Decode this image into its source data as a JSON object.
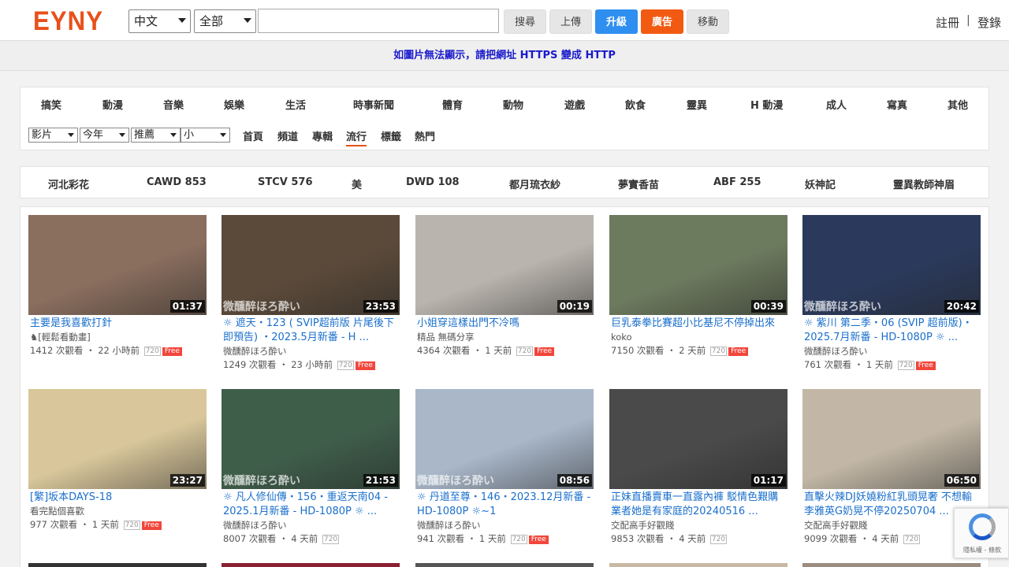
{
  "header": {
    "logo": "EYNY",
    "lang_select": "中文",
    "scope_select": "全部",
    "search_placeholder": "",
    "buttons": {
      "search": "搜尋",
      "upload": "上傳",
      "upgrade": "升級",
      "ads": "廣告",
      "mobile": "移動"
    },
    "register": "註冊",
    "separator": "|",
    "login": "登錄"
  },
  "notice": "如圖片無法顯示，請把網址 HTTPS 變成 HTTP",
  "categories": [
    "搞笑",
    "動漫",
    "音樂",
    "娛樂",
    "生活",
    "時事新聞",
    "體育",
    "動物",
    "遊戲",
    "飲食",
    "靈異",
    "H 動漫",
    "成人",
    "寫真",
    "其他"
  ],
  "filters": {
    "type": "影片",
    "time": "今年",
    "sort": "推薦",
    "size": "小"
  },
  "subnav": [
    "首頁",
    "頻道",
    "專輯",
    "流行",
    "標籤",
    "熱門"
  ],
  "subnav_active": "流行",
  "tags": [
    "河北彩花",
    "CAWD 853",
    "STCV 576",
    "美",
    "DWD 108",
    "都月琉衣紗",
    "夢實香苗",
    "ABF 255",
    "妖神記",
    "靈異教師神眉"
  ],
  "videos": [
    {
      "title": "主要是我喜歡打針",
      "uploader": "♞[輕鬆看動畫]",
      "views": "1412 次觀看",
      "ago": "22 小時前",
      "quality": "720",
      "free": "Free",
      "duration": "01:37",
      "thumb_color": "#8a6e5e"
    },
    {
      "title": "☼ 遮天・123 ( SVIP超前版 片尾後下即預告) ・2023.5月新番 - H ...",
      "uploader": "微醺醉ほろ酔い",
      "views": "1249 次觀看",
      "ago": "23 小時前",
      "quality": "720",
      "free": "Free",
      "duration": "23:53",
      "thumb_color": "#5b4a3a",
      "watermark": "微醺醉ほろ酔い"
    },
    {
      "title": "小姐穿這樣出門不冷嗎",
      "uploader": "精品 無碼分享",
      "views": "4364 次觀看",
      "ago": "1 天前",
      "quality": "720",
      "free": "Free",
      "duration": "00:19",
      "thumb_color": "#b9b4ad"
    },
    {
      "title": "巨乳泰拳比賽超小比基尼不停掉出來",
      "uploader": "koko",
      "views": "7150 次觀看",
      "ago": "2 天前",
      "quality": "720",
      "free": "Free",
      "duration": "00:39",
      "thumb_color": "#6c7a5e"
    },
    {
      "title": "☼ 紫川 第二季・06 (SVIP 超前版)・2025.7月新番 - HD-1080P ☼ ...",
      "uploader": "微醺醉ほろ酔い",
      "views": "761 次觀看",
      "ago": "1 天前",
      "quality": "720",
      "free": "Free",
      "duration": "20:42",
      "thumb_color": "#2b3a5c",
      "watermark": "微醺醉ほろ酔い"
    },
    {
      "title": "[繁]坂本DAYS-18",
      "uploader": "看完點個喜歡",
      "views": "977 次觀看",
      "ago": "1 天前",
      "quality": "720",
      "free": "Free",
      "duration": "23:27",
      "thumb_color": "#d9c79b"
    },
    {
      "title": "☼ 凡人修仙傳・156・重返天南04 - 2025.1月新番 - HD-1080P ☼ ...",
      "uploader": "微醺醉ほろ酔い",
      "views": "8007 次觀看",
      "ago": "4 天前",
      "quality": "720",
      "free": "",
      "duration": "21:53",
      "thumb_color": "#3f5e4a",
      "watermark": "微醺醉ほろ酔い"
    },
    {
      "title": "☼ 丹道至尊・146・2023.12月新番 - HD-1080P ☼~1",
      "uploader": "微醺醉ほろ酔い",
      "views": "941 次觀看",
      "ago": "1 天前",
      "quality": "720",
      "free": "Free",
      "duration": "08:56",
      "thumb_color": "#a9b7c9",
      "watermark": "微醺醉ほろ酔い"
    },
    {
      "title": "正妹直播賣車一直露內褲 駁情色艱購業者她是有家庭的20240516 ...",
      "uploader": "交配高手好觀賤",
      "views": "9853 次觀看",
      "ago": "4 天前",
      "quality": "720",
      "free": "",
      "duration": "01:17",
      "thumb_color": "#4a4a4a"
    },
    {
      "title": "直擊火辣DJ妖嬈粉紅乳頭晃奢 不想輸李雅英G奶晃不停20250704 ...",
      "uploader": "交配高手好觀賤",
      "views": "9099 次觀看",
      "ago": "4 天前",
      "quality": "720",
      "free": "",
      "duration": "06:50",
      "thumb_color": "#c2b7a6"
    }
  ],
  "recaptcha_text": "隱私權 - 條款"
}
